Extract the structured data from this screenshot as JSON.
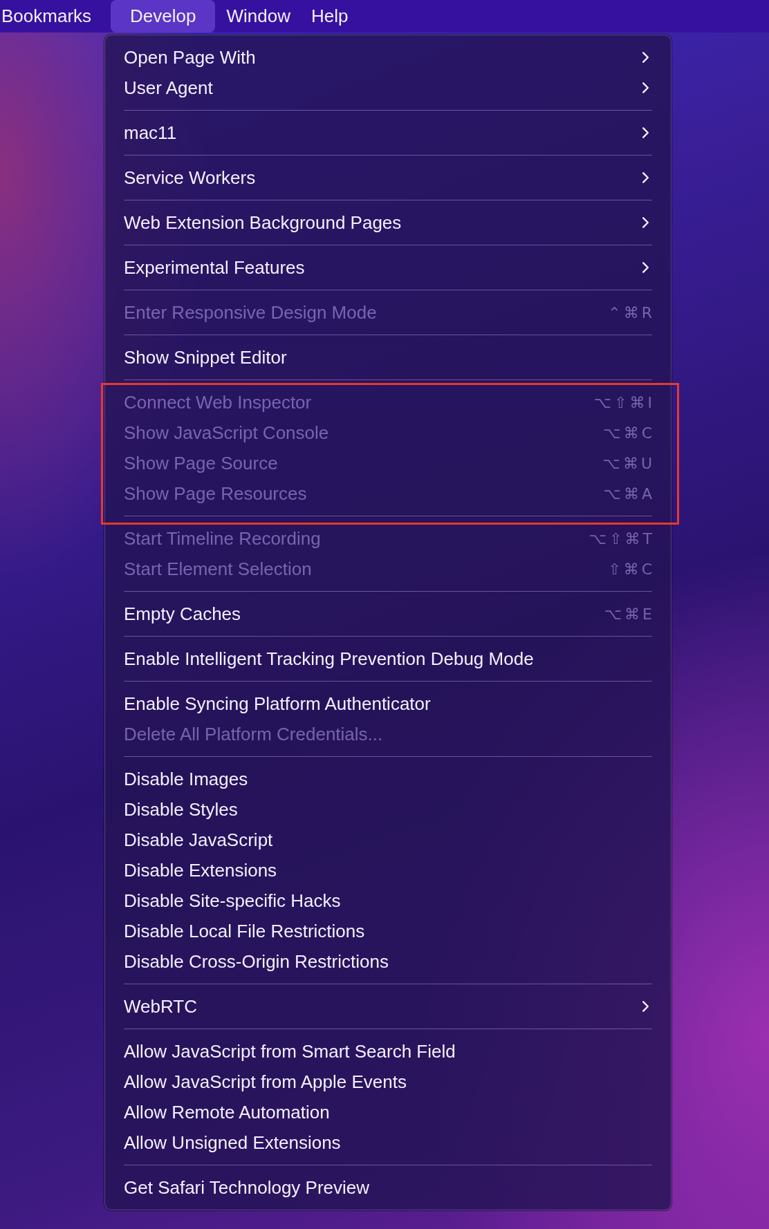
{
  "menubar": [
    {
      "label": "Bookmarks",
      "selected": false
    },
    {
      "label": "Develop",
      "selected": true
    },
    {
      "label": "Window",
      "selected": false
    },
    {
      "label": "Help",
      "selected": false
    }
  ],
  "menu": {
    "sections": [
      {
        "highlighted": false,
        "items": [
          {
            "kind": "submenu",
            "label": "Open Page With",
            "disabled": false
          },
          {
            "kind": "submenu",
            "label": "User Agent",
            "disabled": false
          }
        ]
      },
      {
        "highlighted": false,
        "items": [
          {
            "kind": "submenu",
            "label": "mac11",
            "disabled": false
          }
        ]
      },
      {
        "highlighted": false,
        "items": [
          {
            "kind": "submenu",
            "label": "Service Workers",
            "disabled": false
          }
        ]
      },
      {
        "highlighted": false,
        "items": [
          {
            "kind": "submenu",
            "label": "Web Extension Background Pages",
            "disabled": false
          }
        ]
      },
      {
        "highlighted": false,
        "items": [
          {
            "kind": "submenu",
            "label": "Experimental Features",
            "disabled": false
          }
        ]
      },
      {
        "highlighted": false,
        "items": [
          {
            "kind": "command",
            "label": "Enter Responsive Design Mode",
            "disabled": true,
            "shortcut": "⌃⌘R"
          }
        ]
      },
      {
        "highlighted": false,
        "items": [
          {
            "kind": "command",
            "label": "Show Snippet Editor",
            "disabled": false
          }
        ]
      },
      {
        "highlighted": true,
        "items": [
          {
            "kind": "command",
            "label": "Connect Web Inspector",
            "disabled": true,
            "shortcut": "⌥⇧⌘I"
          },
          {
            "kind": "command",
            "label": "Show JavaScript Console",
            "disabled": true,
            "shortcut": "⌥⌘C"
          },
          {
            "kind": "command",
            "label": "Show Page Source",
            "disabled": true,
            "shortcut": "⌥⌘U"
          },
          {
            "kind": "command",
            "label": "Show Page Resources",
            "disabled": true,
            "shortcut": "⌥⌘A"
          }
        ]
      },
      {
        "highlighted": false,
        "items": [
          {
            "kind": "command",
            "label": "Start Timeline Recording",
            "disabled": true,
            "shortcut": "⌥⇧⌘T"
          },
          {
            "kind": "command",
            "label": "Start Element Selection",
            "disabled": true,
            "shortcut": "⇧⌘C"
          }
        ]
      },
      {
        "highlighted": false,
        "items": [
          {
            "kind": "command",
            "label": "Empty Caches",
            "disabled": false,
            "shortcut": "⌥⌘E"
          }
        ]
      },
      {
        "highlighted": false,
        "items": [
          {
            "kind": "command",
            "label": "Enable Intelligent Tracking Prevention Debug Mode",
            "disabled": false
          }
        ]
      },
      {
        "highlighted": false,
        "items": [
          {
            "kind": "command",
            "label": "Enable Syncing Platform Authenticator",
            "disabled": false
          },
          {
            "kind": "command",
            "label": "Delete All Platform Credentials...",
            "disabled": true
          }
        ]
      },
      {
        "highlighted": false,
        "items": [
          {
            "kind": "command",
            "label": "Disable Images",
            "disabled": false
          },
          {
            "kind": "command",
            "label": "Disable Styles",
            "disabled": false
          },
          {
            "kind": "command",
            "label": "Disable JavaScript",
            "disabled": false
          },
          {
            "kind": "command",
            "label": "Disable Extensions",
            "disabled": false
          },
          {
            "kind": "command",
            "label": "Disable Site-specific Hacks",
            "disabled": false
          },
          {
            "kind": "command",
            "label": "Disable Local File Restrictions",
            "disabled": false
          },
          {
            "kind": "command",
            "label": "Disable Cross-Origin Restrictions",
            "disabled": false
          }
        ]
      },
      {
        "highlighted": false,
        "items": [
          {
            "kind": "submenu",
            "label": "WebRTC",
            "disabled": false
          }
        ]
      },
      {
        "highlighted": false,
        "items": [
          {
            "kind": "command",
            "label": "Allow JavaScript from Smart Search Field",
            "disabled": false
          },
          {
            "kind": "command",
            "label": "Allow JavaScript from Apple Events",
            "disabled": false
          },
          {
            "kind": "command",
            "label": "Allow Remote Automation",
            "disabled": false
          },
          {
            "kind": "command",
            "label": "Allow Unsigned Extensions",
            "disabled": false
          }
        ]
      },
      {
        "highlighted": false,
        "items": [
          {
            "kind": "command",
            "label": "Get Safari Technology Preview",
            "disabled": false
          }
        ]
      }
    ]
  }
}
